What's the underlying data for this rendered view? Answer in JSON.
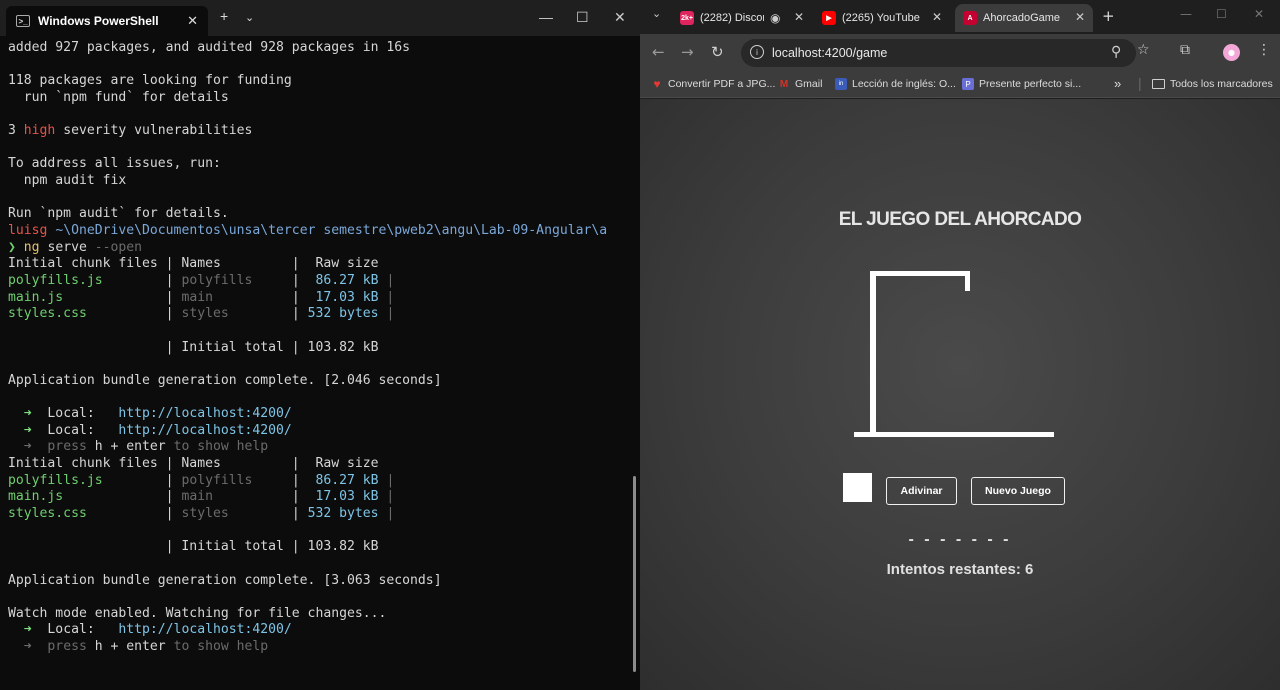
{
  "terminal": {
    "tab_title": "Windows PowerShell",
    "lines": [
      {
        "s": [
          {
            "t": "added 927 packages, and audited 928 packages in 16s",
            "c": ""
          }
        ]
      },
      {
        "s": []
      },
      {
        "s": [
          {
            "t": "118 packages are looking for funding",
            "c": ""
          }
        ]
      },
      {
        "s": [
          {
            "t": "  run `npm fund` for details",
            "c": ""
          }
        ]
      },
      {
        "s": []
      },
      {
        "s": [
          {
            "t": "3 ",
            "c": ""
          },
          {
            "t": "high",
            "c": "c-red"
          },
          {
            "t": " severity vulnerabilities",
            "c": ""
          }
        ]
      },
      {
        "s": []
      },
      {
        "s": [
          {
            "t": "To address all issues, run:",
            "c": ""
          }
        ]
      },
      {
        "s": [
          {
            "t": "  npm audit fix",
            "c": ""
          }
        ]
      },
      {
        "s": []
      },
      {
        "s": [
          {
            "t": "Run `npm audit` for details.",
            "c": ""
          }
        ]
      },
      {
        "s": [
          {
            "t": "luisg ",
            "c": "c-red"
          },
          {
            "t": "~\\OneDrive\\Documentos\\unsa\\tercer semestre\\pweb2\\angu\\Lab-09-Angular\\a",
            "c": "c-blue"
          }
        ]
      },
      {
        "s": [
          {
            "t": "❯ ",
            "c": "c-green"
          },
          {
            "t": "ng",
            "c": "c-yellow"
          },
          {
            "t": " serve ",
            "c": ""
          },
          {
            "t": "--open",
            "c": "c-dim"
          }
        ]
      },
      {
        "s": [
          {
            "t": "Initial chunk files | Names         |  Raw size",
            "c": ""
          }
        ]
      },
      {
        "s": [
          {
            "t": "polyfills.js",
            "c": "c-green"
          },
          {
            "t": "        | ",
            "c": ""
          },
          {
            "t": "polyfills",
            "c": "c-dim"
          },
          {
            "t": "     |  ",
            "c": ""
          },
          {
            "t": "86.27 kB",
            "c": "c-cyan"
          },
          {
            "t": " |",
            "c": "c-dim"
          }
        ]
      },
      {
        "s": [
          {
            "t": "main.js",
            "c": "c-green"
          },
          {
            "t": "             | ",
            "c": ""
          },
          {
            "t": "main",
            "c": "c-dim"
          },
          {
            "t": "          |  ",
            "c": ""
          },
          {
            "t": "17.03 kB",
            "c": "c-cyan"
          },
          {
            "t": " |",
            "c": "c-dim"
          }
        ]
      },
      {
        "s": [
          {
            "t": "styles.css",
            "c": "c-green"
          },
          {
            "t": "          | ",
            "c": ""
          },
          {
            "t": "styles",
            "c": "c-dim"
          },
          {
            "t": "        | ",
            "c": ""
          },
          {
            "t": "532 bytes",
            "c": "c-cyan"
          },
          {
            "t": " |",
            "c": "c-dim"
          }
        ]
      },
      {
        "s": []
      },
      {
        "s": [
          {
            "t": "                    | Initial total | 103.82 kB",
            "c": ""
          }
        ]
      },
      {
        "s": []
      },
      {
        "s": [
          {
            "t": "Application bundle generation complete. [2.046 seconds]",
            "c": ""
          }
        ]
      },
      {
        "s": []
      },
      {
        "s": [
          {
            "t": "  ➜  ",
            "c": "c-lgreen"
          },
          {
            "t": "Local:   ",
            "c": ""
          },
          {
            "t": "http://localhost:4200/",
            "c": "c-cyan"
          }
        ]
      },
      {
        "s": [
          {
            "t": "  ➜  ",
            "c": "c-lgreen"
          },
          {
            "t": "Local:   ",
            "c": ""
          },
          {
            "t": "http://localhost:4200/",
            "c": "c-cyan"
          }
        ]
      },
      {
        "s": [
          {
            "t": "  ➜  ",
            "c": "c-dim"
          },
          {
            "t": "press ",
            "c": "c-dim"
          },
          {
            "t": "h + enter",
            "c": ""
          },
          {
            "t": " to show help",
            "c": "c-dim"
          }
        ]
      },
      {
        "s": [
          {
            "t": "Initial chunk files | Names         |  Raw size",
            "c": ""
          }
        ]
      },
      {
        "s": [
          {
            "t": "polyfills.js",
            "c": "c-green"
          },
          {
            "t": "        | ",
            "c": ""
          },
          {
            "t": "polyfills",
            "c": "c-dim"
          },
          {
            "t": "     |  ",
            "c": ""
          },
          {
            "t": "86.27 kB",
            "c": "c-cyan"
          },
          {
            "t": " |",
            "c": "c-dim"
          }
        ]
      },
      {
        "s": [
          {
            "t": "main.js",
            "c": "c-green"
          },
          {
            "t": "             | ",
            "c": ""
          },
          {
            "t": "main",
            "c": "c-dim"
          },
          {
            "t": "          |  ",
            "c": ""
          },
          {
            "t": "17.03 kB",
            "c": "c-cyan"
          },
          {
            "t": " |",
            "c": "c-dim"
          }
        ]
      },
      {
        "s": [
          {
            "t": "styles.css",
            "c": "c-green"
          },
          {
            "t": "          | ",
            "c": ""
          },
          {
            "t": "styles",
            "c": "c-dim"
          },
          {
            "t": "        | ",
            "c": ""
          },
          {
            "t": "532 bytes",
            "c": "c-cyan"
          },
          {
            "t": " |",
            "c": "c-dim"
          }
        ]
      },
      {
        "s": []
      },
      {
        "s": [
          {
            "t": "                    | Initial total | 103.82 kB",
            "c": ""
          }
        ]
      },
      {
        "s": []
      },
      {
        "s": [
          {
            "t": "Application bundle generation complete. [3.063 seconds]",
            "c": ""
          }
        ]
      },
      {
        "s": []
      },
      {
        "s": [
          {
            "t": "Watch mode enabled. Watching for file changes...",
            "c": ""
          }
        ]
      },
      {
        "s": [
          {
            "t": "  ➜  ",
            "c": "c-lgreen"
          },
          {
            "t": "Local:   ",
            "c": ""
          },
          {
            "t": "http://localhost:4200/",
            "c": "c-cyan"
          }
        ]
      },
      {
        "s": [
          {
            "t": "  ➜  ",
            "c": "c-dim"
          },
          {
            "t": "press ",
            "c": "c-dim"
          },
          {
            "t": "h + enter",
            "c": ""
          },
          {
            "t": " to show help",
            "c": "c-dim"
          }
        ]
      }
    ]
  },
  "browser": {
    "tabs": [
      {
        "label": "(2282) Discord",
        "favicon_text": "2k+",
        "favicon_color": "#e0245e",
        "active": false
      },
      {
        "label": "(2265) YouTube",
        "favicon_text": "▶",
        "favicon_color": "#ff0000",
        "active": false
      },
      {
        "label": "AhorcadoGame",
        "favicon_text": "A",
        "favicon_color": "#c3002f",
        "active": true
      }
    ],
    "url": "localhost:4200/game",
    "bookmarks": [
      {
        "label": "Convertir PDF a JPG...",
        "icon": "heart-icon",
        "icon_glyph": "♥",
        "icon_color": "#e53935"
      },
      {
        "label": "Gmail",
        "icon": "gmail-icon",
        "icon_glyph": "M",
        "icon_color": "#d93025"
      },
      {
        "label": "Lección de inglés: O...",
        "icon": "lesson-icon",
        "icon_glyph": "in",
        "icon_color": "#3a5bb8"
      },
      {
        "label": "Presente perfecto si...",
        "icon": "doc-icon",
        "icon_glyph": "P",
        "icon_color": "#6a6fd8"
      }
    ],
    "all_bookmarks_label": "Todos los marcadores"
  },
  "game": {
    "title": "EL JUEGO DEL AHORCADO",
    "guess_button": "Adivinar",
    "new_game_button": "Nuevo Juego",
    "word_display": "- - - - - - -",
    "attempts_text": "Intentos restantes: 6",
    "accent_color": "#ffffff"
  }
}
